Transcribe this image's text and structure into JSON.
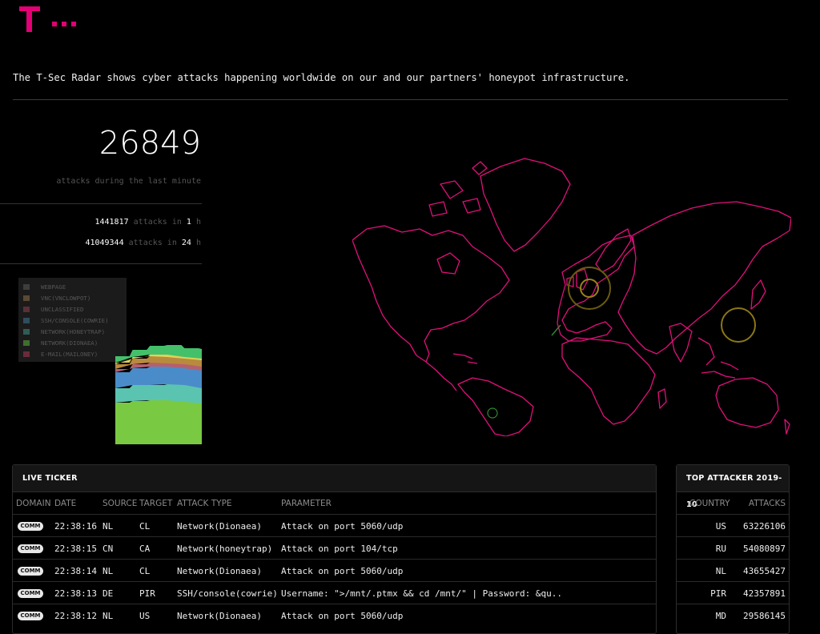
{
  "header": {
    "intro": "The T-Sec Radar shows cyber attacks happening worldwide on our and our partners' honeypot infrastructure."
  },
  "stats": {
    "last_minute": "26849",
    "last_minute_caption": "attacks during the last minute",
    "hour_value": "1441817",
    "hour_text": "attacks in",
    "hour_n": "1",
    "hour_unit": "h",
    "day_value": "41049344",
    "day_text": "attacks in",
    "day_n": "24",
    "day_unit": "h"
  },
  "legend": {
    "items": [
      {
        "label": "WEBPAGE",
        "color": "#3d3d3d"
      },
      {
        "label": "VNC(VNCLOWPOT)",
        "color": "#5a4a30"
      },
      {
        "label": "UNCLASSIFIED",
        "color": "#5a2f37"
      },
      {
        "label": "SSH/CONSOLE(COWRIE)",
        "color": "#2e4d5e"
      },
      {
        "label": "NETWORK(HONEYTRAP)",
        "color": "#2f5c55"
      },
      {
        "label": "NETWORK(DIONAEA)",
        "color": "#3f6f2e"
      },
      {
        "label": "E-MAIL(MAILONEY)",
        "color": "#6a2b3a"
      }
    ]
  },
  "chart_data": {
    "type": "area",
    "series": [
      {
        "name": "NETWORK(DIONAEA)",
        "color": "#7ac943",
        "values": [
          52,
          54,
          55,
          55,
          53,
          51
        ]
      },
      {
        "name": "NETWORK(HONEYTRAP)",
        "color": "#5bc4b0",
        "values": [
          18,
          20,
          19,
          20,
          21,
          19
        ]
      },
      {
        "name": "SSH/CONSOLE(COWRIE)",
        "color": "#4a8cc9",
        "values": [
          20,
          21,
          23,
          22,
          21,
          22
        ]
      },
      {
        "name": "UNCLASSIFIED",
        "color": "#b5606e",
        "values": [
          4,
          5,
          5,
          4,
          5,
          5
        ]
      },
      {
        "name": "VNC(VNCLOWPOT)",
        "color": "#b88a3e",
        "values": [
          6,
          7,
          8,
          8,
          7,
          8
        ]
      },
      {
        "name": "WEBPAGE",
        "color": "#e0d25a",
        "values": [
          2,
          2,
          2,
          3,
          2,
          2
        ]
      },
      {
        "name": "E-MAIL(MAILONEY)",
        "color": "#44c06a",
        "values": [
          8,
          9,
          11,
          12,
          11,
          12
        ]
      }
    ],
    "ymax": 150
  },
  "live_ticker": {
    "title": "LIVE TICKER",
    "columns": [
      "DOMAIN",
      "DATE",
      "SOURCE",
      "TARGET",
      "ATTACK TYPE",
      "PARAMETER"
    ],
    "rows": [
      {
        "domain": "COMM",
        "date": "22:38:16",
        "source": "NL",
        "target": "CL",
        "type": "Network(Dionaea)",
        "param": "Attack on port 5060/udp"
      },
      {
        "domain": "COMM",
        "date": "22:38:15",
        "source": "CN",
        "target": "CA",
        "type": "Network(honeytrap)",
        "param": "Attack on port 104/tcp"
      },
      {
        "domain": "COMM",
        "date": "22:38:14",
        "source": "NL",
        "target": "CL",
        "type": "Network(Dionaea)",
        "param": "Attack on port 5060/udp"
      },
      {
        "domain": "COMM",
        "date": "22:38:13",
        "source": "DE",
        "target": "PIR",
        "type": "SSH/console(cowrie)",
        "param": "Username: \">/mnt/.ptmx && cd /mnt/\" | Password: &qu.."
      },
      {
        "domain": "COMM",
        "date": "22:38:12",
        "source": "NL",
        "target": "US",
        "type": "Network(Dionaea)",
        "param": "Attack on port 5060/udp"
      }
    ]
  },
  "top_attacker": {
    "title": "TOP ATTACKER 2019-10",
    "columns": [
      "COUNTRY",
      "ATTACKS"
    ],
    "rows": [
      {
        "country": "US",
        "attacks": "63226106"
      },
      {
        "country": "RU",
        "attacks": "54080897"
      },
      {
        "country": "NL",
        "attacks": "43655427"
      },
      {
        "country": "PIR",
        "attacks": "42357891"
      },
      {
        "country": "MD",
        "attacks": "29586145"
      }
    ]
  }
}
